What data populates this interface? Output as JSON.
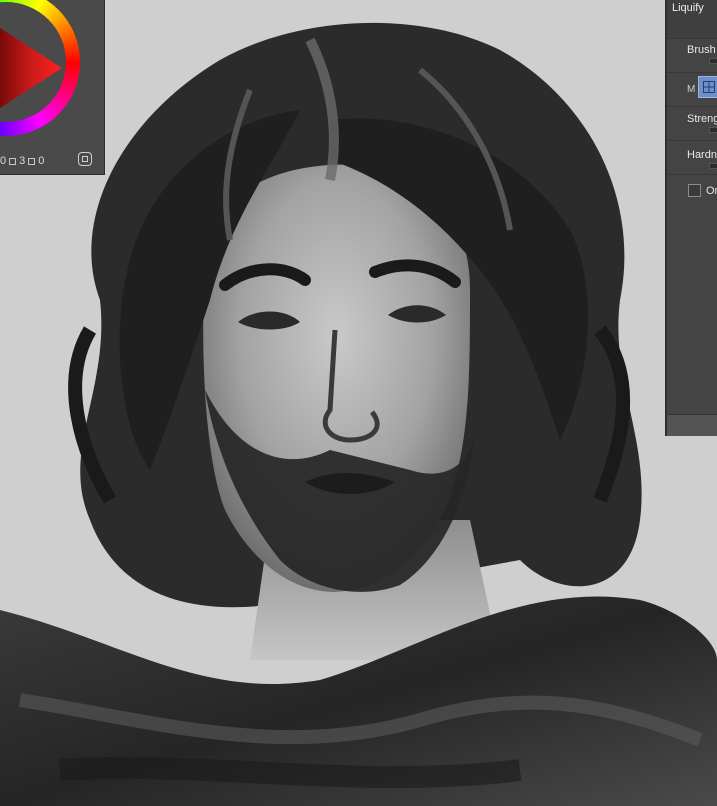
{
  "tool_panel": {
    "title": "Liquify",
    "brush_label": "Brush",
    "mode_label": "M",
    "strength_label": "Streng",
    "hardness_label": "Hardne",
    "checkbox_label": "On",
    "mode_icon": "liquify-grid-icon"
  },
  "color_panel": {
    "value_a": "0",
    "value_b": "3",
    "value_c": "0",
    "hue_color": "#ff2020",
    "icons": [
      "color-wheel-icon",
      "palette-toggle-icon"
    ]
  },
  "canvas": {
    "background": "#cfcfcf",
    "content": "digital-painting"
  }
}
